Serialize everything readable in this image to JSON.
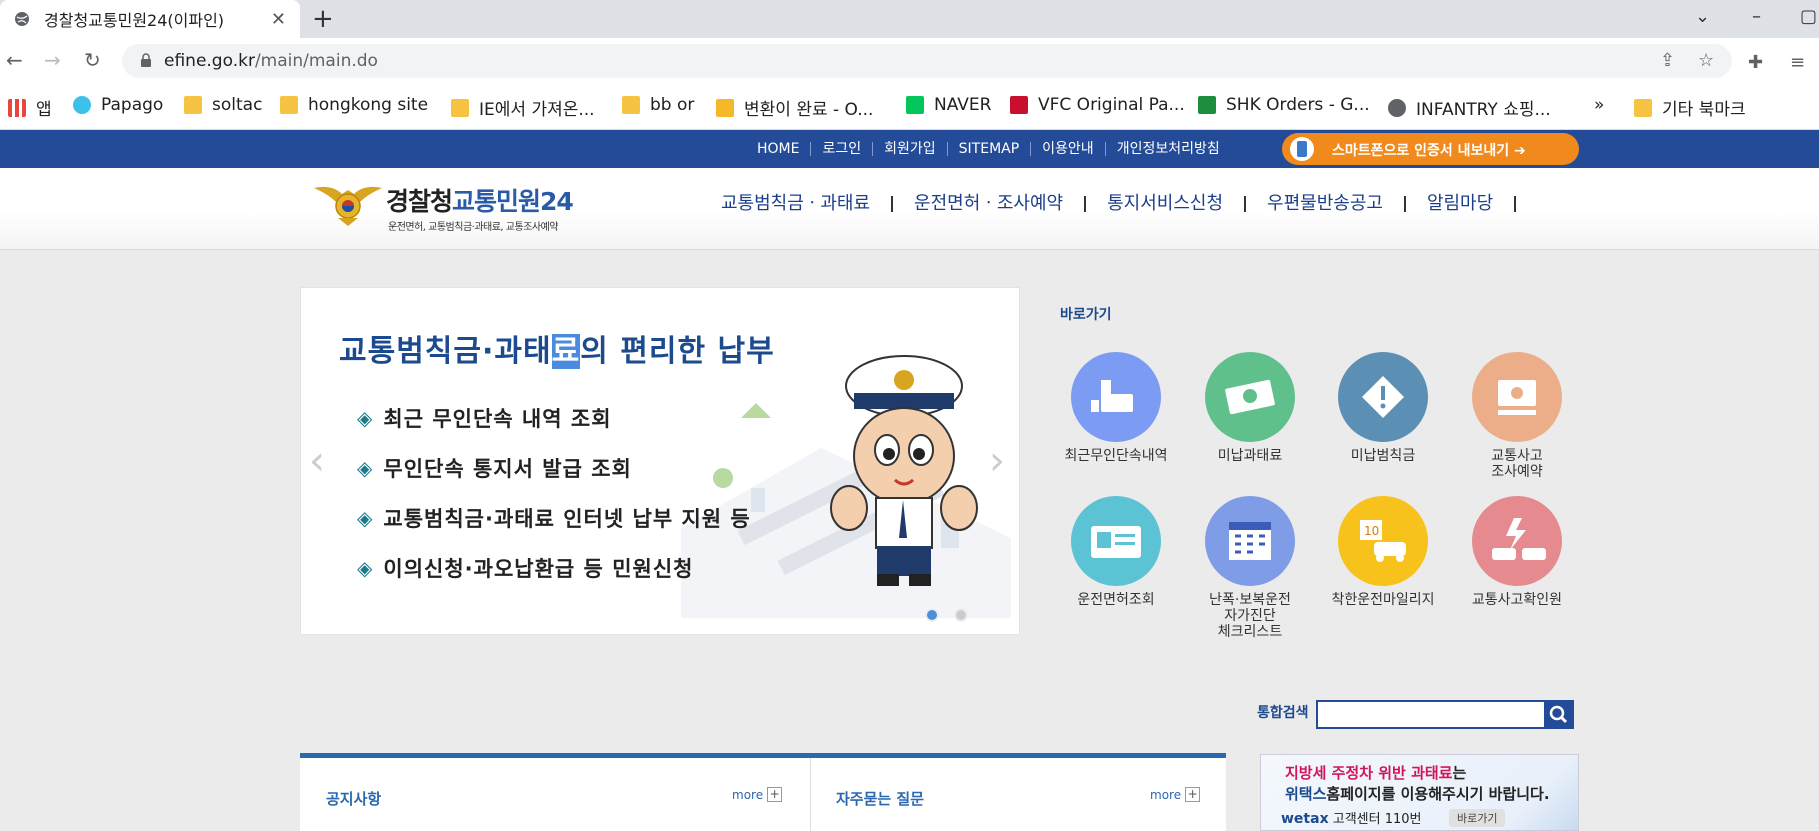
{
  "browser": {
    "tab_title": "경찰청교통민원24(이파인)",
    "url_host": "efine.go.kr",
    "url_path": "/main/main.do",
    "bookmarks": [
      {
        "label": "앱"
      },
      {
        "label": "Papago"
      },
      {
        "label": "soltac"
      },
      {
        "label": "hongkong site"
      },
      {
        "label": "IE에서 가져온..."
      },
      {
        "label": "bb or"
      },
      {
        "label": "변환이 완료 - O..."
      },
      {
        "label": "NAVER"
      },
      {
        "label": "VFC Original Pa..."
      },
      {
        "label": "SHK Orders - G..."
      },
      {
        "label": "INFANTRY 쇼핑..."
      },
      {
        "label": "»"
      },
      {
        "label": "기타 북마크"
      }
    ]
  },
  "utility": {
    "links": [
      "HOME",
      "로그인",
      "회원가입",
      "SITEMAP",
      "이용안내",
      "개인정보처리방침"
    ],
    "smartphone_button": "스마트폰으로 인증서 내보내기"
  },
  "header": {
    "brand_a": "경찰청",
    "brand_b": "교통민원24",
    "brand_sub": "운전면허, 교통범칙금·과태료, 교통조사예약",
    "gnb": [
      "교통범칙금ㆍ과태료",
      "운전면허ㆍ조사예약",
      "통지서비스신청",
      "우편물반송공고",
      "알림마당"
    ]
  },
  "slider": {
    "title_a": "교통범칙금·과태",
    "title_hl": "료",
    "title_b": "의 편리한 납부",
    "items": [
      "최근 무인단속 내역 조회",
      "무인단속 통지서 발급 조회",
      "교통범칙금·과태료 인터넷 납부 지원 등",
      "이의신청·과오납환급 등 민원신청"
    ],
    "bullet": "◈",
    "prev": "‹",
    "next": "›"
  },
  "quick": {
    "title": "바로가기",
    "items": [
      {
        "l1": "최근무인단속내역",
        "l2": "",
        "l3": "",
        "icon": "camera-icon",
        "color": "#7b9cf2"
      },
      {
        "l1": "미납과태료",
        "l2": "",
        "l3": "",
        "icon": "money-icon",
        "color": "#5fc08c"
      },
      {
        "l1": "미납범칙금",
        "l2": "",
        "l3": "",
        "icon": "warning-sign-icon",
        "color": "#5b8fb3"
      },
      {
        "l1": "교통사고",
        "l2": "조사예약",
        "l3": "",
        "icon": "computer-icon",
        "color": "#ecae88"
      },
      {
        "l1": "운전면허조회",
        "l2": "",
        "l3": "",
        "icon": "license-card-icon",
        "color": "#5bc3d3"
      },
      {
        "l1": "난폭·보복운전",
        "l2": "자가진단",
        "l3": "체크리스트",
        "icon": "calendar-checklist-icon",
        "color": "#7f9de6"
      },
      {
        "l1": "착한운전마일리지",
        "l2": "",
        "l3": "",
        "icon": "mileage-car-icon",
        "color": "#f7c21b"
      },
      {
        "l1": "교통사고확인원",
        "l2": "",
        "l3": "",
        "icon": "car-crash-icon",
        "color": "#e58b8f"
      }
    ]
  },
  "search": {
    "label": "통합검색",
    "placeholder": ""
  },
  "boards": {
    "notice": {
      "title": "공지사항",
      "more": "more"
    },
    "faq": {
      "title": "자주묻는 질문",
      "more": "more"
    }
  },
  "banner": {
    "l1a": "지방세 주정차 위반 과태료",
    "l1b": "는",
    "l2a": "위택스",
    "l2b": "홈페이지를 이용해주시기 바랍니다.",
    "l3a": "wetax",
    "l3b": " 고객센터 110번",
    "go": "바로가기"
  },
  "colors": {
    "site_blue": "#234b97",
    "accent_orange": "#f08a1c"
  }
}
